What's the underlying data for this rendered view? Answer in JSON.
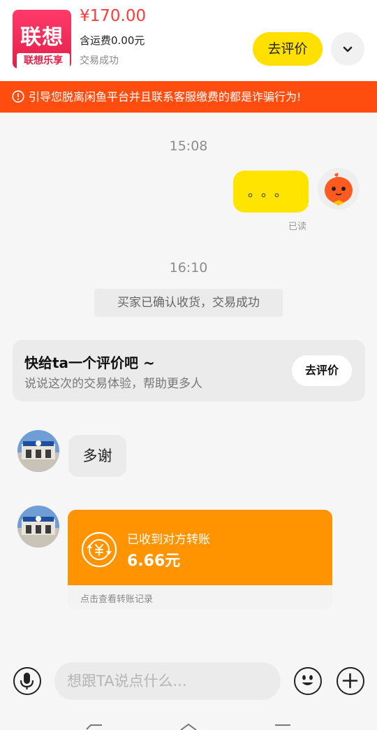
{
  "header": {
    "product_logo_text": "联想",
    "product_logo_sub": "联想乐享",
    "price": "¥170.00",
    "shipping": "含运费0.00元",
    "status": "交易成功",
    "review_button": "去评价"
  },
  "warning": {
    "text": "引导您脱离闲鱼平台并且联系客服缴费的都是诈骗行为!"
  },
  "chat": {
    "time1": "15:08",
    "my_message": "。。。",
    "read_status": "已读",
    "time2": "16:10",
    "system_message": "买家已确认收货，交易成功",
    "review_card": {
      "title": "快给ta一个评价吧 ~",
      "subtitle": "说说这次的交易体验，帮助更多人",
      "button": "去评价"
    },
    "other_message": "多谢",
    "transfer": {
      "label": "已收到对方转账",
      "amount": "6.66元",
      "footer": "点击查看转账记录"
    }
  },
  "input_bar": {
    "placeholder": "想跟TA说点什么..."
  },
  "colors": {
    "accent_yellow": "#ffe000",
    "warning_orange": "#ff4d0f",
    "transfer_orange": "#ff9400",
    "price_red": "#ff3a3a"
  },
  "icons": {
    "expand": "chevron-down-icon",
    "warning": "exclamation-circle-icon",
    "transfer": "yuan-exchange-icon",
    "voice": "microphone-icon",
    "emoji": "smiley-icon",
    "more": "plus-icon"
  }
}
